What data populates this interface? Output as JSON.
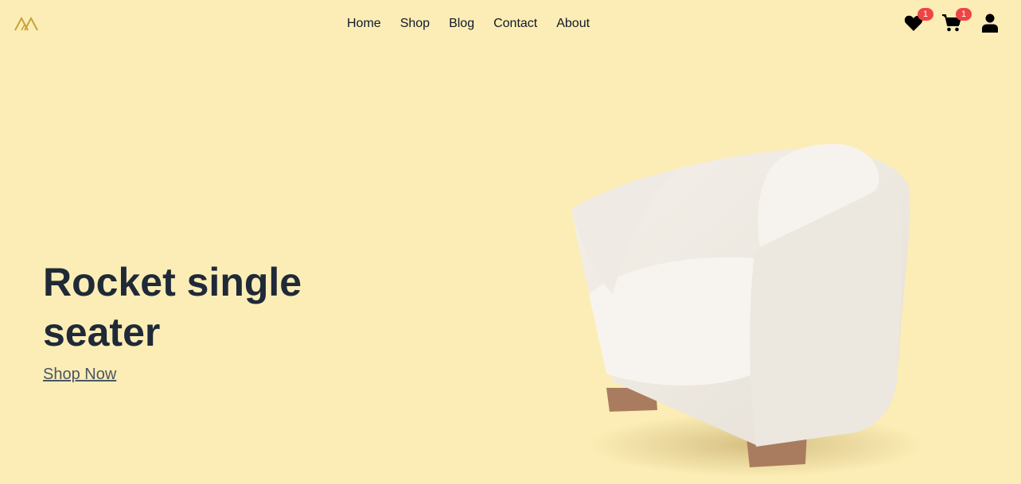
{
  "header": {
    "logo_name": "brand-logo",
    "nav": [
      {
        "label": "Home"
      },
      {
        "label": "Shop"
      },
      {
        "label": "Blog"
      },
      {
        "label": "Contact"
      },
      {
        "label": "About"
      }
    ],
    "wishlist_count": "1",
    "cart_count": "1"
  },
  "hero": {
    "title": "Rocket single seater",
    "cta_label": "Shop Now"
  },
  "colors": {
    "background": "#fbedb5",
    "accent_logo": "#c9a23c",
    "badge": "#ef4444",
    "heading": "#1f2937"
  },
  "icons": [
    "heart-icon",
    "cart-icon",
    "user-icon"
  ]
}
